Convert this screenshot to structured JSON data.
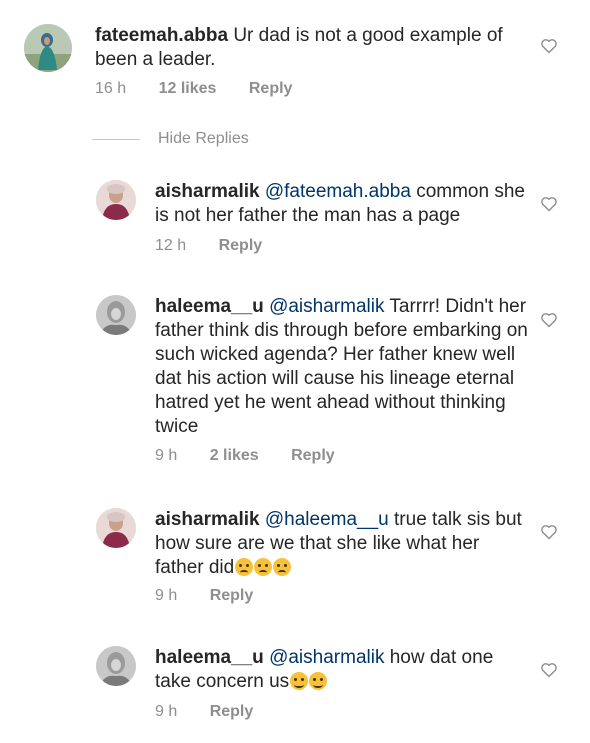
{
  "hide_replies_label": "Hide Replies",
  "comments": [
    {
      "username": "fateemah.abba",
      "mention": "",
      "text": "Ur dad is not a good example of been a leader.",
      "time": "16 h",
      "likes": "12 likes",
      "reply": "Reply",
      "avatar_icon": "profile-avatar-hijab"
    },
    {
      "username": "aisharmalik",
      "mention": "@fateemah.abba",
      "text": "common she is not her father the man has a page",
      "time": "12 h",
      "likes": "",
      "reply": "Reply",
      "avatar_icon": "profile-avatar"
    },
    {
      "username": "haleema__u",
      "mention": "@aisharmalik",
      "text": "Tarrrr! Didn't her father  think dis through before embarking on such wicked agenda? Her father knew well dat his action will cause his lineage eternal hatred yet he went ahead without thinking twice",
      "time": "9 h",
      "likes": "2 likes",
      "reply": "Reply",
      "avatar_icon": "profile-avatar-grayscale"
    },
    {
      "username": "aisharmalik",
      "mention": "@haleema__u",
      "text": "true talk sis but how sure are we that she like what her father did",
      "time": "9 h",
      "likes": "",
      "reply": "Reply",
      "avatar_icon": "profile-avatar",
      "emojis": [
        "crying-face-emoji",
        "crying-face-emoji",
        "crying-face-emoji"
      ]
    },
    {
      "username": "haleema__u",
      "mention": "@aisharmalik",
      "text": "how dat one take concern us",
      "time": "9 h",
      "likes": "",
      "reply": "Reply",
      "avatar_icon": "profile-avatar-grayscale",
      "emojis": [
        "grinning-face-emoji",
        "grinning-face-emoji"
      ]
    }
  ],
  "colors": {
    "text": "#262626",
    "mention": "#003569",
    "meta": "#8e8e8e",
    "divider": "#c7c7c7",
    "emoji": "#f7c23b"
  },
  "icons": {
    "like": "heart-outline-icon"
  }
}
